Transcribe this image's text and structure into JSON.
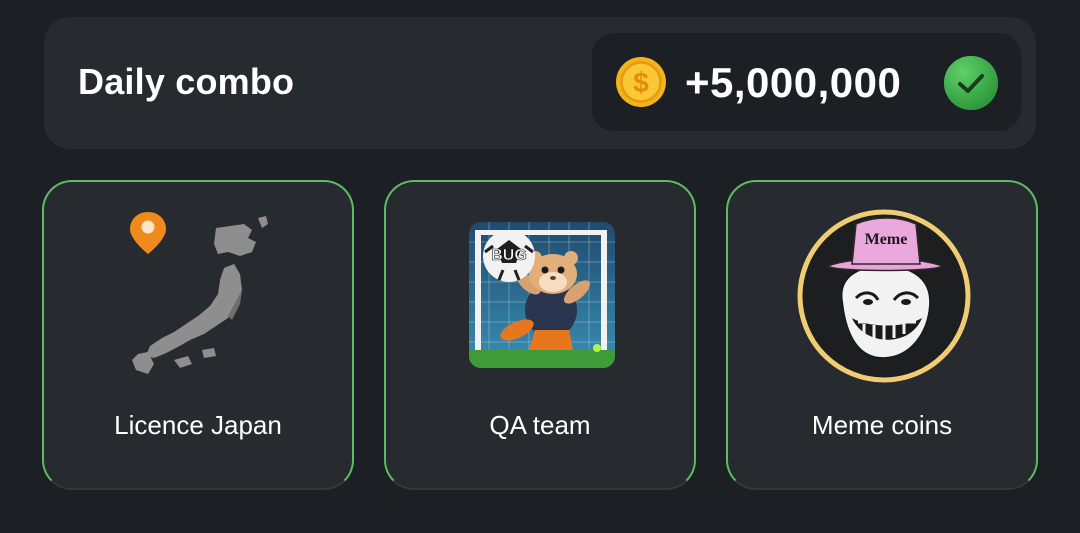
{
  "header": {
    "title": "Daily combo",
    "reward_amount": "+5,000,000",
    "coin_icon": "dollar-coin-icon",
    "status_icon": "check-circle-icon"
  },
  "cards": [
    {
      "label": "Licence Japan",
      "image": "japan-map-with-pin"
    },
    {
      "label": "QA team",
      "image": "hamster-goalkeeper-bug-ball",
      "ball_text": "BUG"
    },
    {
      "label": "Meme coins",
      "image": "trollface-in-pink-hat",
      "hat_text": "Meme"
    }
  ],
  "colors": {
    "background": "#1c1f24",
    "panel": "#272a2f",
    "card_border": "#5dbb63",
    "coin_gold": "#f5b31b",
    "check_green": "#3fb04e"
  }
}
